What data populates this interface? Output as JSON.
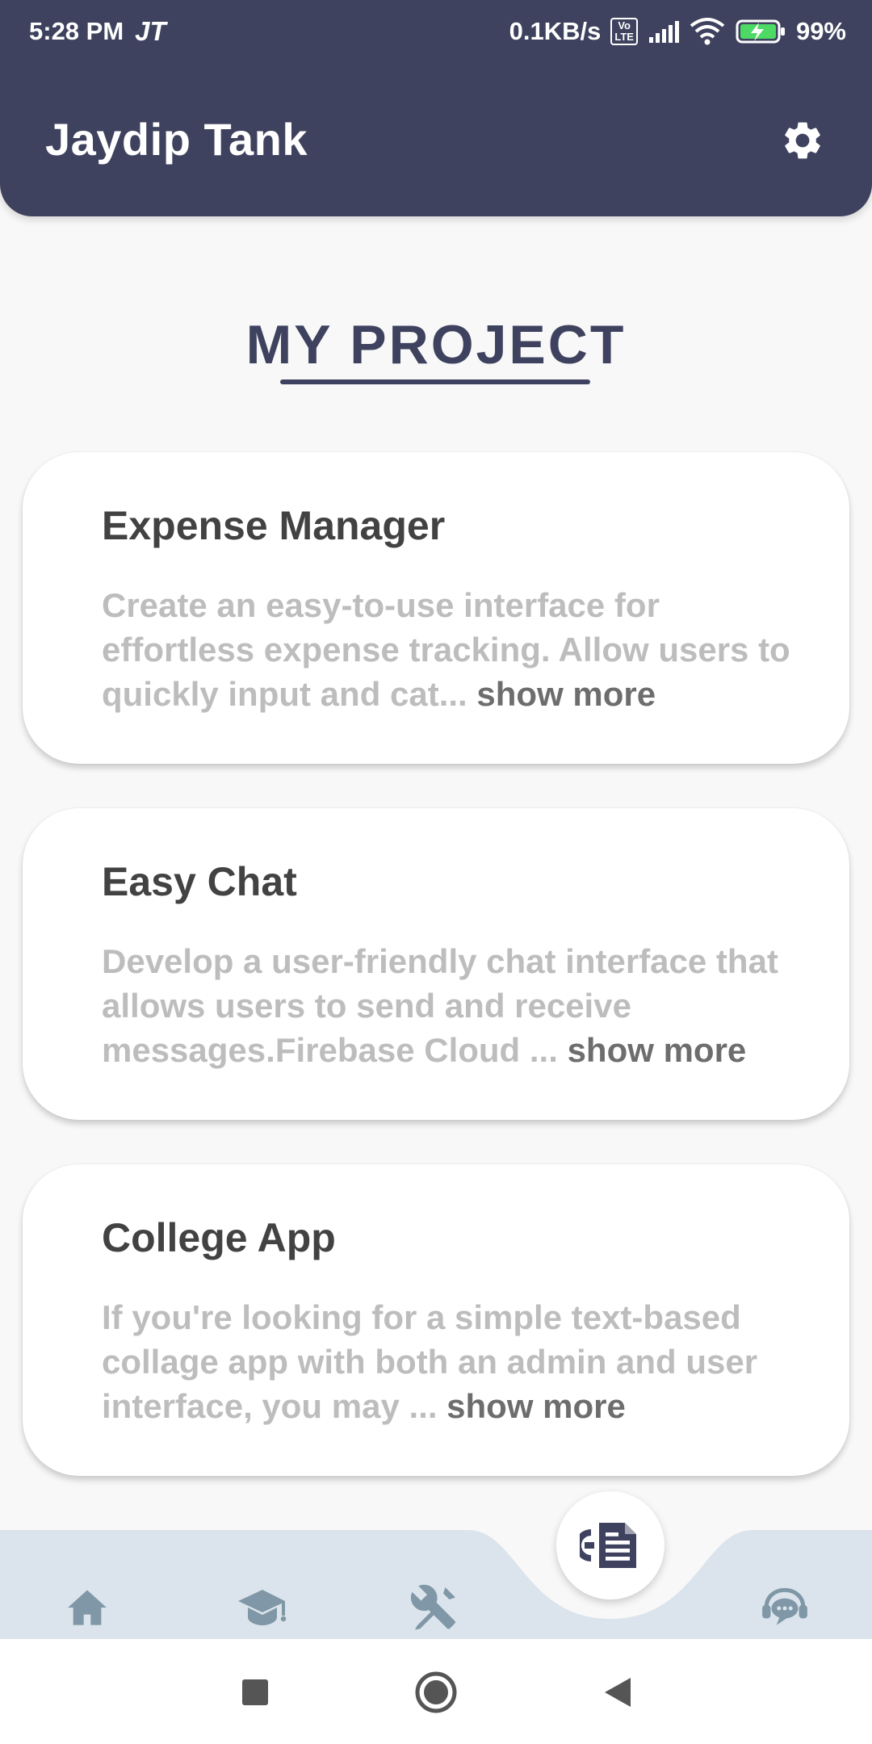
{
  "status_bar": {
    "time": "5:28 PM",
    "carrier": "JT",
    "network_speed": "0.1KB/s",
    "volte_top": "Vo",
    "volte_bottom": "LTE",
    "battery": "99%"
  },
  "header": {
    "title": "Jaydip Tank",
    "settings_icon": "gear-icon"
  },
  "section": {
    "title": "MY PROJECT"
  },
  "projects": [
    {
      "title": "Expense Manager",
      "description": "Create an easy-to-use interface for effortless expense tracking. Allow users to quickly input and cat...",
      "show_more": "show more"
    },
    {
      "title": "Easy Chat",
      "description": "Develop a user-friendly chat interface that allows users to send and receive messages.Firebase Cloud ...",
      "show_more": "show more"
    },
    {
      "title": "College App",
      "description": "If you're looking for a simple text-based collage app with both an admin and user interface, you may ...",
      "show_more": "show more"
    }
  ],
  "bottom_nav": {
    "items": [
      "home-icon",
      "graduation-cap-icon",
      "tools-icon",
      "project-icon",
      "chat-support-icon"
    ],
    "active": "project-icon",
    "bar_color": "#dbe4ec",
    "icon_color": "#7f97a6",
    "active_icon_color": "#3e425e"
  },
  "colors": {
    "primary": "#3e425e",
    "background": "#f8f8f8",
    "card": "#ffffff",
    "card_title": "#424242",
    "card_desc": "#bdbdbd",
    "show_more": "#6d6d6d"
  }
}
